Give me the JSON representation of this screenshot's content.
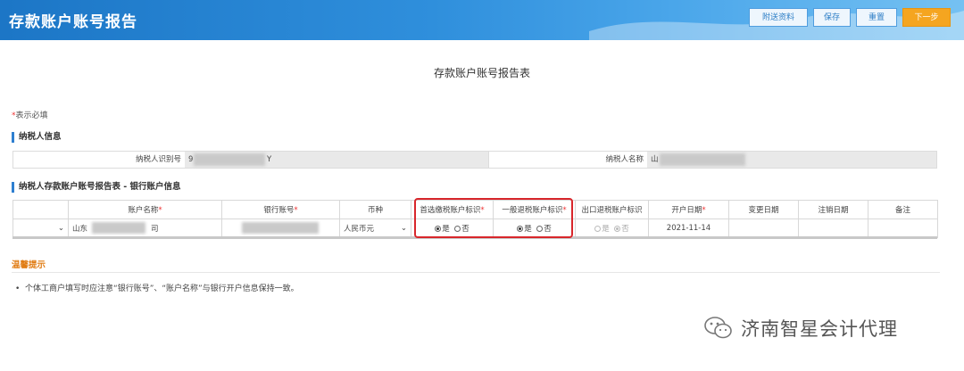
{
  "header": {
    "title": "存款账户账号报告",
    "buttons": {
      "attach": "附送资料",
      "save": "保存",
      "reset": "重置",
      "next": "下一步"
    }
  },
  "form": {
    "title": "存款账户账号报告表",
    "required_note": "表示必填",
    "required_mark": "*"
  },
  "taxpayer": {
    "section_title": "纳税人信息",
    "id_label": "纳税人识别号",
    "id_value_prefix": "9",
    "id_value_suffix": "Y",
    "name_label": "纳税人名称",
    "name_value_prefix": "山"
  },
  "bank": {
    "section_title": "纳税人存款账户账号报告表 - 银行账户信息",
    "columns": {
      "account_name": "账户名称",
      "bank_account": "银行账号",
      "currency": "币种",
      "first_tax_account": "首选缴税账户标识",
      "general_refund_account": "一般退税账户标识",
      "export_refund_account": "出口退税账户标识",
      "open_date": "开户日期",
      "change_date": "变更日期",
      "cancel_date": "注销日期",
      "remarks": "备注"
    },
    "row": {
      "account_name_prefix": "山东",
      "account_name_suffix": "司",
      "currency": "人民币元",
      "yes": "是",
      "no": "否",
      "open_date": "2021-11-14",
      "change_date": "",
      "cancel_date": "",
      "remarks": ""
    }
  },
  "tips": {
    "title": "温馨提示",
    "items": [
      "个体工商户填写时应注意“银行账号”、“账户名称”与银行开户信息保持一致。"
    ]
  },
  "watermark": {
    "text": "济南智星会计代理"
  },
  "colors": {
    "header_blue": "#1c76c6",
    "primary_orange": "#f5a520",
    "highlight_red": "#d8262b",
    "tip_orange": "#e07a10"
  }
}
